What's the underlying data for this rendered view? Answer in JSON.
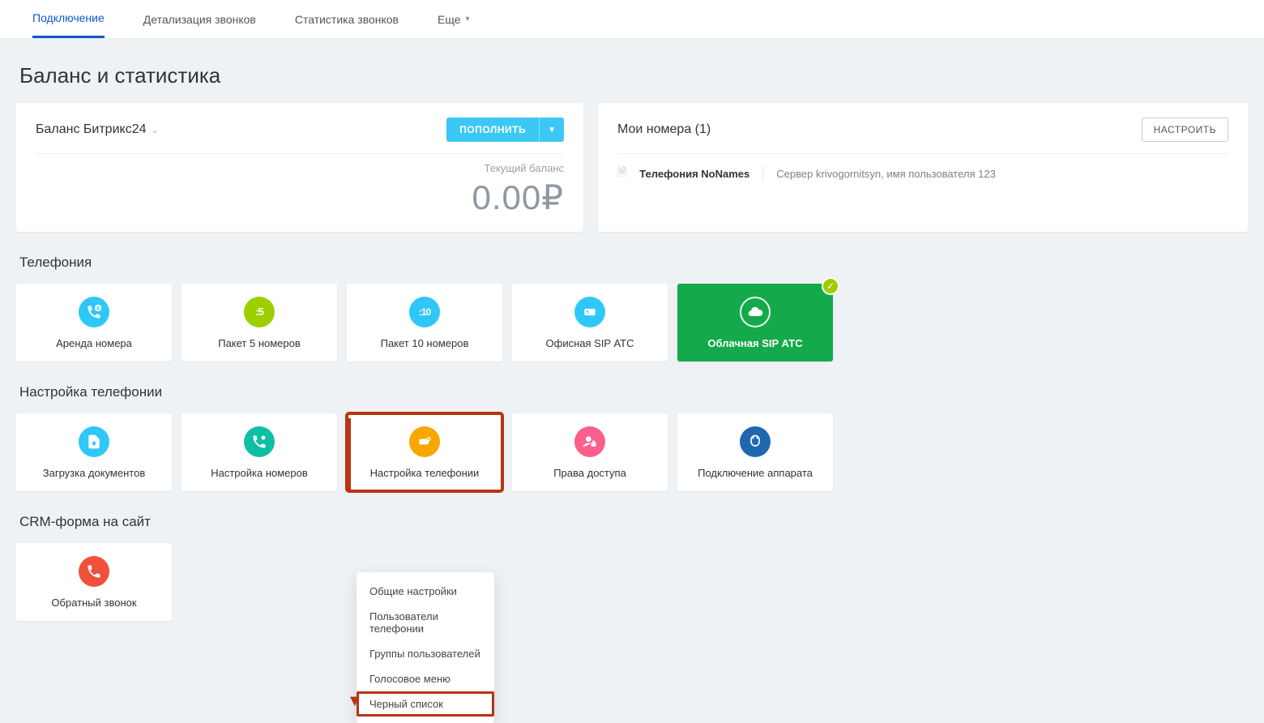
{
  "tabs": {
    "connection": "Подключение",
    "details": "Детализация звонков",
    "stats": "Статистика звонков",
    "more": "Еще"
  },
  "page_title": "Баланс и статистика",
  "balance_panel": {
    "title": "Баланс Битрикс24",
    "topup_btn": "ПОПОЛНИТЬ",
    "current_label": "Текущий баланс",
    "value": "0.00₽"
  },
  "numbers_panel": {
    "title": "Мои номера (1)",
    "configure_btn": "НАСТРОИТЬ",
    "entry_name": "Телефония NoNames",
    "entry_server": "Сервер krivogornitsyn, имя пользователя 123"
  },
  "sections": {
    "telephony": "Телефония",
    "settings": "Настройка телефонии",
    "crm_form": "CRM-форма на сайт"
  },
  "tiles_telephony": {
    "t0": "Аренда номера",
    "t1": "Пакет 5 номеров",
    "t2": "Пакет 10 номеров",
    "t3": "Офисная SIP АТС",
    "t4": "Облачная SIP АТС"
  },
  "tiles_settings": {
    "s0": "Загрузка документов",
    "s1": "Настройка номеров",
    "s2": "Настройка телефонии",
    "s3": "Права доступа",
    "s4": "Подключение аппарата"
  },
  "tiles_crm": {
    "c0": "Обратный звонок"
  },
  "dropdown": {
    "d0": "Общие настройки",
    "d1": "Пользователи телефонии",
    "d2": "Группы пользователей",
    "d3": "Голосовое меню",
    "d4": "Черный список"
  },
  "icon_text": {
    "badge5": ":5",
    "badge10": ":10"
  }
}
